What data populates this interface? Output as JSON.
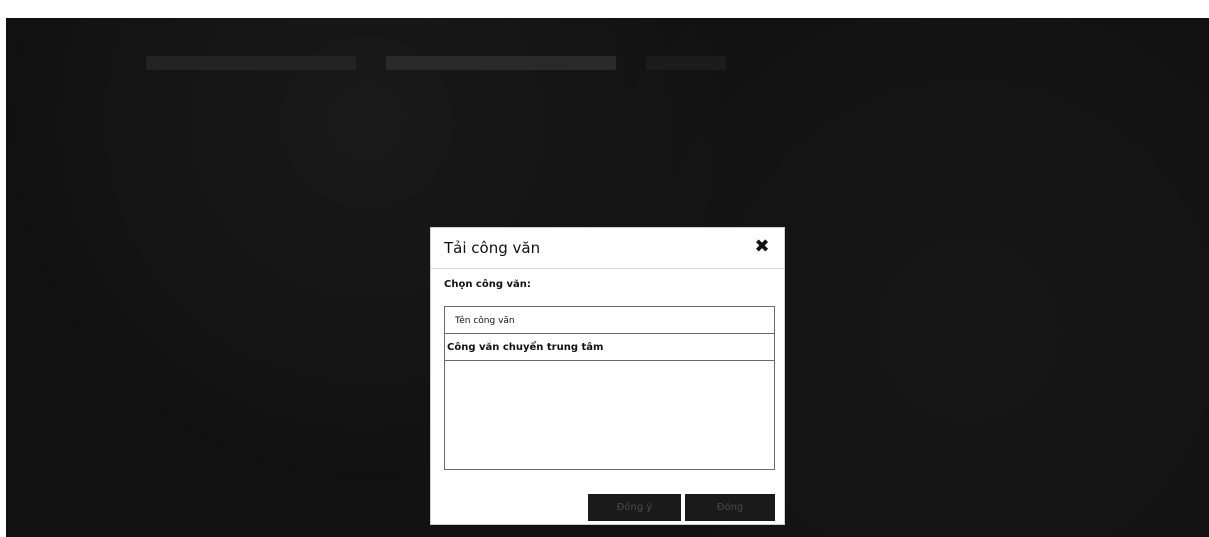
{
  "dialog": {
    "title": "Tải công văn",
    "close_icon": "close-icon",
    "select_label": "Chọn công văn:",
    "list": {
      "header": "Tên công văn",
      "rows": [
        "Công văn chuyển trung tâm"
      ]
    },
    "buttons": {
      "agree": "Đồng ý",
      "close": "Đóng"
    }
  },
  "colors": {
    "overlay": "#111111",
    "dialog_bg": "#ffffff",
    "button_bg": "#1a1a1a",
    "button_text": "#4a4a4a"
  }
}
